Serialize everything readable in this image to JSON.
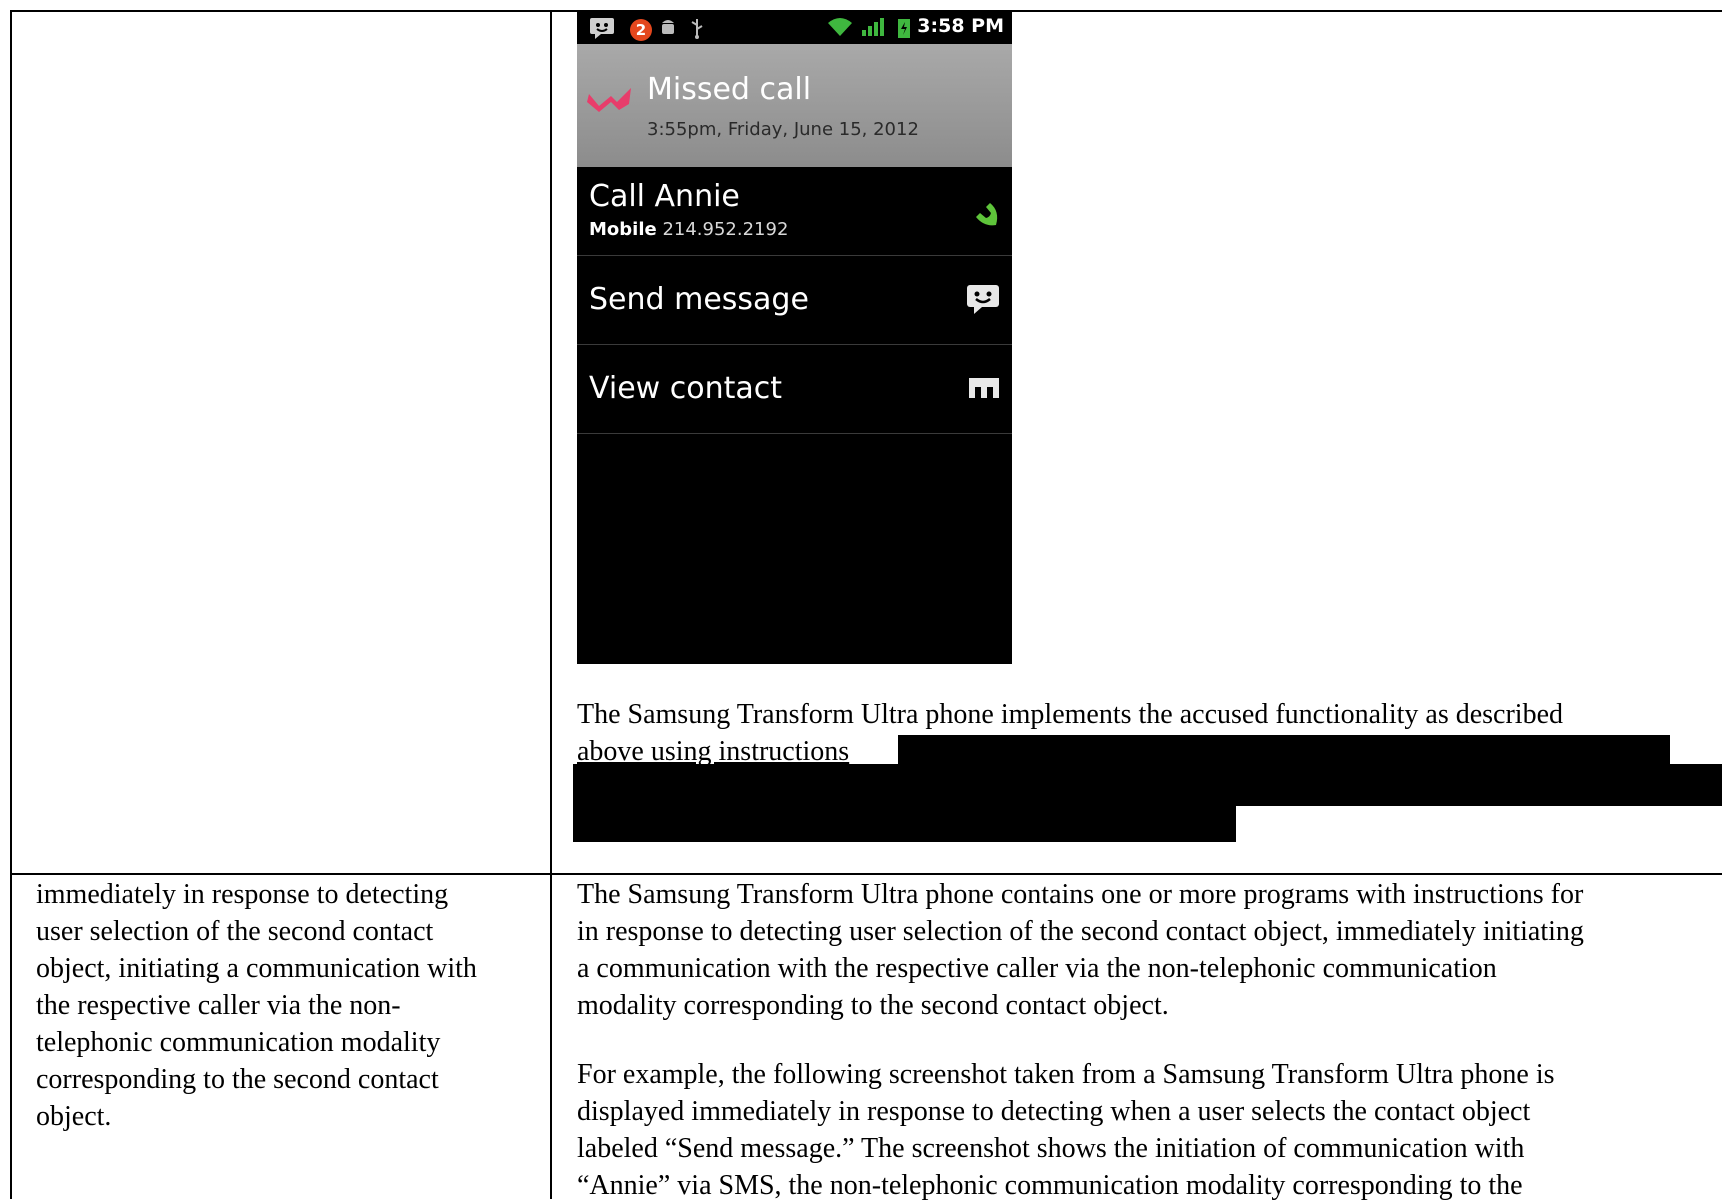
{
  "phone": {
    "status_bar": {
      "notification_count": "2",
      "time": "3:58 PM"
    },
    "notification": {
      "title": "Missed call",
      "timestamp": "3:55pm, Friday, June 15, 2012"
    },
    "options": [
      {
        "label": "Call Annie",
        "sub_label": "Mobile",
        "sub_value": "214.952.2192",
        "icon": "phone-icon"
      },
      {
        "label": "Send message",
        "icon": "message-icon"
      },
      {
        "label": "View contact",
        "icon": "contact-card-icon"
      }
    ],
    "colors": {
      "missed_icon": "#e83d6b",
      "call_icon": "#5ec43a"
    }
  },
  "right_column": {
    "caption_line1": "The Samsung Transform Ultra phone implements the accused functionality as described",
    "caption_line2": "above using instructions",
    "claim_paragraph": [
      "The Samsung Transform Ultra phone contains one or more programs with instructions for",
      "in response to detecting user selection of the second contact object, immediately initiating",
      "a communication with the respective caller via the non-telephonic communication",
      "modality corresponding to the second contact object."
    ],
    "example_paragraph": [
      "For example, the following screenshot taken from a Samsung Transform Ultra phone is",
      "displayed immediately in response to detecting when a user selects the contact object",
      "labeled “Send message.”  The screenshot shows the initiation of communication with",
      "“Annie” via SMS, the non-telephonic communication modality corresponding to the"
    ]
  },
  "left_column": {
    "claim_text": [
      "immediately in response to detecting",
      "user selection of the second contact",
      "object, initiating a communication with",
      "the respective caller via the non-",
      "telephonic communication modality",
      "corresponding to the second contact",
      "object."
    ]
  }
}
